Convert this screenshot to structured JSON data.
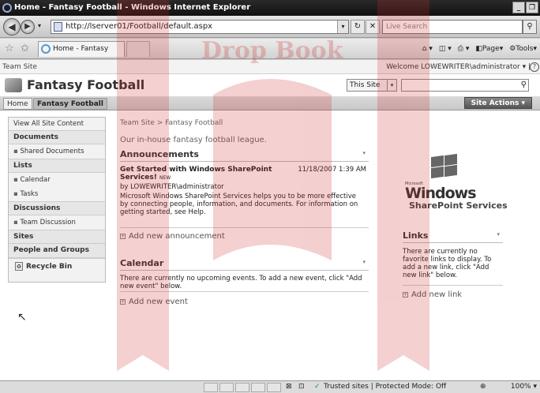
{
  "browser": {
    "title": "Home - Fantasy Football - Windows Internet Explorer",
    "address": "http://lserver01/Football/default.aspx",
    "search_placeholder": "Live Search",
    "tab_label": "Home - Fantasy Football",
    "cmd_page": "Page",
    "cmd_tools": "Tools"
  },
  "sharepoint": {
    "top_site": "Team Site",
    "welcome": "Welcome LOWEWRITER\\administrator ▾ |",
    "site_title": "Fantasy Football",
    "scope": "This Site",
    "nav_home": "Home",
    "nav_fantasy": "Fantasy Football",
    "site_actions": "Site Actions ▾",
    "breadcrumb": "Team Site > Fantasy Football",
    "description": "Our in-house fantasy football league."
  },
  "quicklaunch": {
    "view_all": "View All Site Content",
    "documents": "Documents",
    "shared_documents": "Shared Documents",
    "lists": "Lists",
    "calendar": "Calendar",
    "tasks": "Tasks",
    "discussions": "Discussions",
    "team_discussion": "Team Discussion",
    "sites": "Sites",
    "people_groups": "People and Groups",
    "recycle_bin": "Recycle Bin"
  },
  "announcements": {
    "title": "Announcements",
    "item_title": "Get Started with Windows SharePoint Services!",
    "item_new": "NEW",
    "item_date": "11/18/2007 1:39 AM",
    "item_by": "by LOWEWRITER\\administrator",
    "item_body": "Microsoft Windows SharePoint Services helps you to be more effective by connecting people, information, and documents. For information on getting started, see Help.",
    "add_new": "Add new announcement"
  },
  "calendar": {
    "title": "Calendar",
    "body": "There are currently no upcoming events. To add a new event, click \"Add new event\" below.",
    "add_new": "Add new event"
  },
  "links": {
    "title": "Links",
    "body": "There are currently no favorite links to display. To add a new link, click \"Add new link\" below.",
    "add_new": "Add new link"
  },
  "logo": {
    "microsoft": "Microsoft",
    "windows": "Windows",
    "sharepoint_services": "SharePoint Services"
  },
  "status": {
    "zone": "Trusted sites | Protected Mode: Off",
    "zoom": "100%"
  },
  "watermark_text": "Drop Book",
  "colors": {
    "watermark": "#cc2a2a"
  }
}
